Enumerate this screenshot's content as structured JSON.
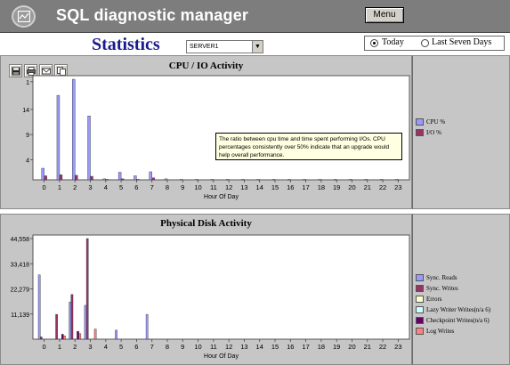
{
  "app": {
    "title": "SQL diagnostic manager",
    "menu_label": "Menu"
  },
  "page": {
    "title": "Statistics",
    "server": "SERVER1",
    "range_options": [
      "Today",
      "Last Seven Days"
    ],
    "range_selected": "Today"
  },
  "icons": [
    "app-logo-icon",
    "save-icon",
    "print-icon",
    "email-icon",
    "copy-icon"
  ],
  "colors": {
    "cpu": "#9999ff",
    "io": "#993366",
    "errors": "#ffffcc",
    "lazy": "#ccffff",
    "checkpoint": "#660066",
    "log": "#ff8080"
  },
  "tooltip": "The ratio between cpu time and time spent performing I/Os. CPU percentages consistently over 50% indicate that an upgrade would help overall performance.",
  "chart_data": [
    {
      "type": "bar",
      "title": "CPU / IO Activity",
      "xlabel": "Hour Of Day",
      "ylabel": "",
      "categories": [
        "0",
        "1",
        "2",
        "3",
        "4",
        "5",
        "6",
        "7",
        "8",
        "9",
        "10",
        "11",
        "12",
        "13",
        "14",
        "15",
        "16",
        "17",
        "18",
        "19",
        "20",
        "21",
        "22",
        "23"
      ],
      "y_ticks": [
        "4",
        "9",
        "14",
        "1"
      ],
      "ylim": [
        0,
        20
      ],
      "series": [
        {
          "name": "CPU %",
          "color": "#9999ff",
          "values": [
            2.3,
            16.8,
            20,
            12.7,
            0.2,
            1.5,
            0.8,
            1.6,
            0.2,
            0.1,
            0.1,
            0.1,
            0.1,
            0.1,
            0.1,
            0.1,
            0.1,
            0.1,
            0.1,
            0.1,
            0.1,
            0.1,
            0.1,
            0.1
          ]
        },
        {
          "name": "I/O %",
          "color": "#993366",
          "values": [
            0.8,
            1.0,
            0.9,
            0.7,
            0.1,
            0.2,
            0.1,
            0.4,
            0,
            0,
            0,
            0,
            0,
            0,
            0,
            0,
            0,
            0,
            0,
            0,
            0,
            0,
            0,
            0
          ]
        }
      ],
      "legend": "right"
    },
    {
      "type": "bar",
      "title": "Physical Disk Activity",
      "xlabel": "Hour Of Day",
      "ylabel": "",
      "categories": [
        "0",
        "1",
        "2",
        "3",
        "4",
        "5",
        "6",
        "7",
        "8",
        "9",
        "10",
        "11",
        "12",
        "13",
        "14",
        "15",
        "16",
        "17",
        "18",
        "19",
        "20",
        "21",
        "22",
        "23"
      ],
      "y_ticks": [
        "11,139",
        "22,279",
        "33,418",
        "44,558"
      ],
      "ylim": [
        0,
        44558
      ],
      "series": [
        {
          "name": "Sync. Reads",
          "color": "#9999ff",
          "values": [
            28500,
            0,
            16500,
            15000,
            0,
            4000,
            0,
            11000,
            0,
            0,
            0,
            0,
            0,
            0,
            0,
            0,
            0,
            0,
            0,
            0,
            0,
            0,
            0,
            0
          ]
        },
        {
          "name": "Sync. Writes",
          "color": "#993366",
          "values": [
            1000,
            11000,
            19800,
            44558,
            0,
            0,
            0,
            0,
            0,
            0,
            0,
            0,
            0,
            0,
            0,
            0,
            0,
            0,
            0,
            0,
            0,
            0,
            0,
            0
          ]
        },
        {
          "name": "Errors",
          "color": "#ffffcc",
          "values": [
            0,
            0,
            0,
            0,
            0,
            0,
            0,
            0,
            0,
            0,
            0,
            0,
            0,
            0,
            0,
            0,
            0,
            0,
            0,
            0,
            0,
            0,
            0,
            0
          ]
        },
        {
          "name": "Lazy Writer Writes(n/a 6)",
          "color": "#ccffff",
          "values": [
            0,
            0,
            0,
            0,
            0,
            0,
            0,
            0,
            0,
            0,
            0,
            0,
            0,
            0,
            0,
            0,
            0,
            0,
            0,
            0,
            0,
            0,
            0,
            0
          ]
        },
        {
          "name": "Checkpoint Writes(n/a 6)",
          "color": "#660066",
          "values": [
            0,
            2200,
            3500,
            0,
            0,
            0,
            0,
            0,
            0,
            0,
            0,
            0,
            0,
            0,
            0,
            0,
            0,
            0,
            0,
            0,
            0,
            0,
            0,
            0
          ]
        },
        {
          "name": "Log Writes",
          "color": "#ff8080",
          "values": [
            0,
            1500,
            2500,
            4500,
            0,
            0,
            0,
            0,
            0,
            0,
            0,
            0,
            0,
            0,
            0,
            0,
            0,
            0,
            0,
            0,
            0,
            0,
            0,
            0
          ]
        }
      ],
      "legend": "right"
    }
  ]
}
